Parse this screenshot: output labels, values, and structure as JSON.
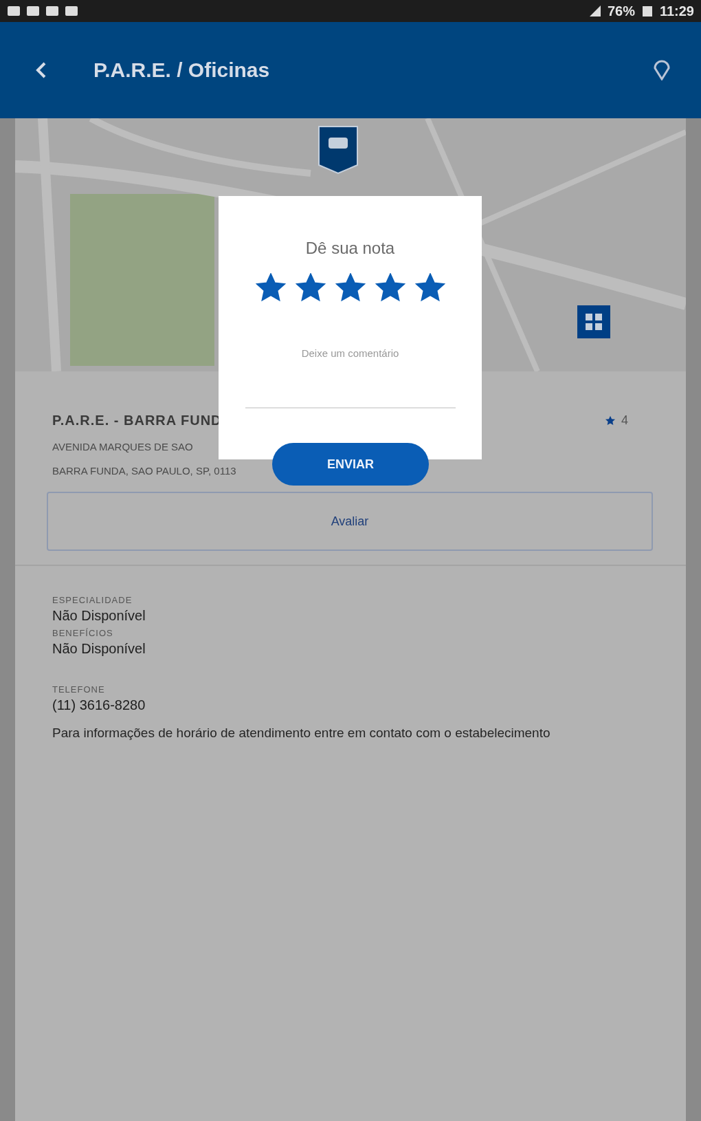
{
  "status_bar": {
    "battery": "76%",
    "time": "11:29"
  },
  "app_bar": {
    "title": "P.A.R.E. / Oficinas"
  },
  "place": {
    "name": "P.A.R.E. - BARRA FUND",
    "rating": "4",
    "address_lines": [
      "AVENIDA MARQUES DE SAO",
      "BARRA FUNDA, SAO PAULO, SP, 0113"
    ],
    "rate_button": "Avaliar"
  },
  "details": [
    {
      "label": "ESPECIALIDADE",
      "value": "Não Disponível"
    },
    {
      "label": "BENEFÍCIOS",
      "value": "Não Disponível"
    },
    {
      "label": "TELEFONE",
      "value": "(11) 3616-8280"
    }
  ],
  "note": "Para informações de horário de atendimento entre em contato com o estabelecimento",
  "dialog": {
    "title": "Dê sua nota",
    "stars": 5,
    "comment": {
      "placeholder": "Deixe um comentário"
    },
    "submit": "ENVIAR"
  }
}
